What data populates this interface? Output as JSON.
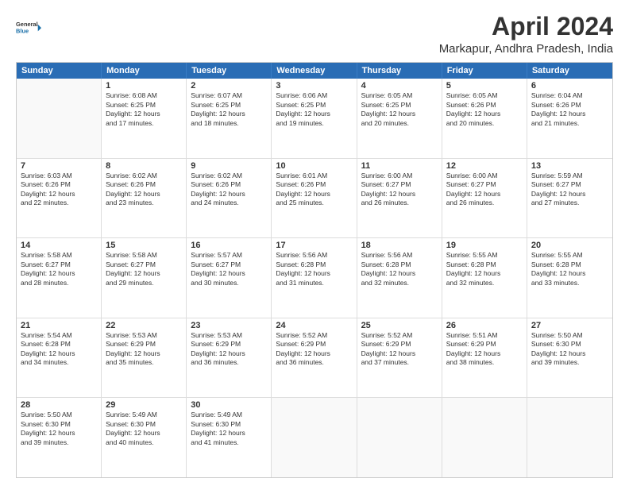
{
  "logo": {
    "line1": "General",
    "line2": "Blue"
  },
  "title": "April 2024",
  "subtitle": "Markapur, Andhra Pradesh, India",
  "header": {
    "days": [
      "Sunday",
      "Monday",
      "Tuesday",
      "Wednesday",
      "Thursday",
      "Friday",
      "Saturday"
    ]
  },
  "weeks": [
    [
      {
        "day": "",
        "info": ""
      },
      {
        "day": "1",
        "info": "Sunrise: 6:08 AM\nSunset: 6:25 PM\nDaylight: 12 hours\nand 17 minutes."
      },
      {
        "day": "2",
        "info": "Sunrise: 6:07 AM\nSunset: 6:25 PM\nDaylight: 12 hours\nand 18 minutes."
      },
      {
        "day": "3",
        "info": "Sunrise: 6:06 AM\nSunset: 6:25 PM\nDaylight: 12 hours\nand 19 minutes."
      },
      {
        "day": "4",
        "info": "Sunrise: 6:05 AM\nSunset: 6:25 PM\nDaylight: 12 hours\nand 20 minutes."
      },
      {
        "day": "5",
        "info": "Sunrise: 6:05 AM\nSunset: 6:26 PM\nDaylight: 12 hours\nand 20 minutes."
      },
      {
        "day": "6",
        "info": "Sunrise: 6:04 AM\nSunset: 6:26 PM\nDaylight: 12 hours\nand 21 minutes."
      }
    ],
    [
      {
        "day": "7",
        "info": "Sunrise: 6:03 AM\nSunset: 6:26 PM\nDaylight: 12 hours\nand 22 minutes."
      },
      {
        "day": "8",
        "info": "Sunrise: 6:02 AM\nSunset: 6:26 PM\nDaylight: 12 hours\nand 23 minutes."
      },
      {
        "day": "9",
        "info": "Sunrise: 6:02 AM\nSunset: 6:26 PM\nDaylight: 12 hours\nand 24 minutes."
      },
      {
        "day": "10",
        "info": "Sunrise: 6:01 AM\nSunset: 6:26 PM\nDaylight: 12 hours\nand 25 minutes."
      },
      {
        "day": "11",
        "info": "Sunrise: 6:00 AM\nSunset: 6:27 PM\nDaylight: 12 hours\nand 26 minutes."
      },
      {
        "day": "12",
        "info": "Sunrise: 6:00 AM\nSunset: 6:27 PM\nDaylight: 12 hours\nand 26 minutes."
      },
      {
        "day": "13",
        "info": "Sunrise: 5:59 AM\nSunset: 6:27 PM\nDaylight: 12 hours\nand 27 minutes."
      }
    ],
    [
      {
        "day": "14",
        "info": "Sunrise: 5:58 AM\nSunset: 6:27 PM\nDaylight: 12 hours\nand 28 minutes."
      },
      {
        "day": "15",
        "info": "Sunrise: 5:58 AM\nSunset: 6:27 PM\nDaylight: 12 hours\nand 29 minutes."
      },
      {
        "day": "16",
        "info": "Sunrise: 5:57 AM\nSunset: 6:27 PM\nDaylight: 12 hours\nand 30 minutes."
      },
      {
        "day": "17",
        "info": "Sunrise: 5:56 AM\nSunset: 6:28 PM\nDaylight: 12 hours\nand 31 minutes."
      },
      {
        "day": "18",
        "info": "Sunrise: 5:56 AM\nSunset: 6:28 PM\nDaylight: 12 hours\nand 32 minutes."
      },
      {
        "day": "19",
        "info": "Sunrise: 5:55 AM\nSunset: 6:28 PM\nDaylight: 12 hours\nand 32 minutes."
      },
      {
        "day": "20",
        "info": "Sunrise: 5:55 AM\nSunset: 6:28 PM\nDaylight: 12 hours\nand 33 minutes."
      }
    ],
    [
      {
        "day": "21",
        "info": "Sunrise: 5:54 AM\nSunset: 6:28 PM\nDaylight: 12 hours\nand 34 minutes."
      },
      {
        "day": "22",
        "info": "Sunrise: 5:53 AM\nSunset: 6:29 PM\nDaylight: 12 hours\nand 35 minutes."
      },
      {
        "day": "23",
        "info": "Sunrise: 5:53 AM\nSunset: 6:29 PM\nDaylight: 12 hours\nand 36 minutes."
      },
      {
        "day": "24",
        "info": "Sunrise: 5:52 AM\nSunset: 6:29 PM\nDaylight: 12 hours\nand 36 minutes."
      },
      {
        "day": "25",
        "info": "Sunrise: 5:52 AM\nSunset: 6:29 PM\nDaylight: 12 hours\nand 37 minutes."
      },
      {
        "day": "26",
        "info": "Sunrise: 5:51 AM\nSunset: 6:29 PM\nDaylight: 12 hours\nand 38 minutes."
      },
      {
        "day": "27",
        "info": "Sunrise: 5:50 AM\nSunset: 6:30 PM\nDaylight: 12 hours\nand 39 minutes."
      }
    ],
    [
      {
        "day": "28",
        "info": "Sunrise: 5:50 AM\nSunset: 6:30 PM\nDaylight: 12 hours\nand 39 minutes."
      },
      {
        "day": "29",
        "info": "Sunrise: 5:49 AM\nSunset: 6:30 PM\nDaylight: 12 hours\nand 40 minutes."
      },
      {
        "day": "30",
        "info": "Sunrise: 5:49 AM\nSunset: 6:30 PM\nDaylight: 12 hours\nand 41 minutes."
      },
      {
        "day": "",
        "info": ""
      },
      {
        "day": "",
        "info": ""
      },
      {
        "day": "",
        "info": ""
      },
      {
        "day": "",
        "info": ""
      }
    ]
  ]
}
